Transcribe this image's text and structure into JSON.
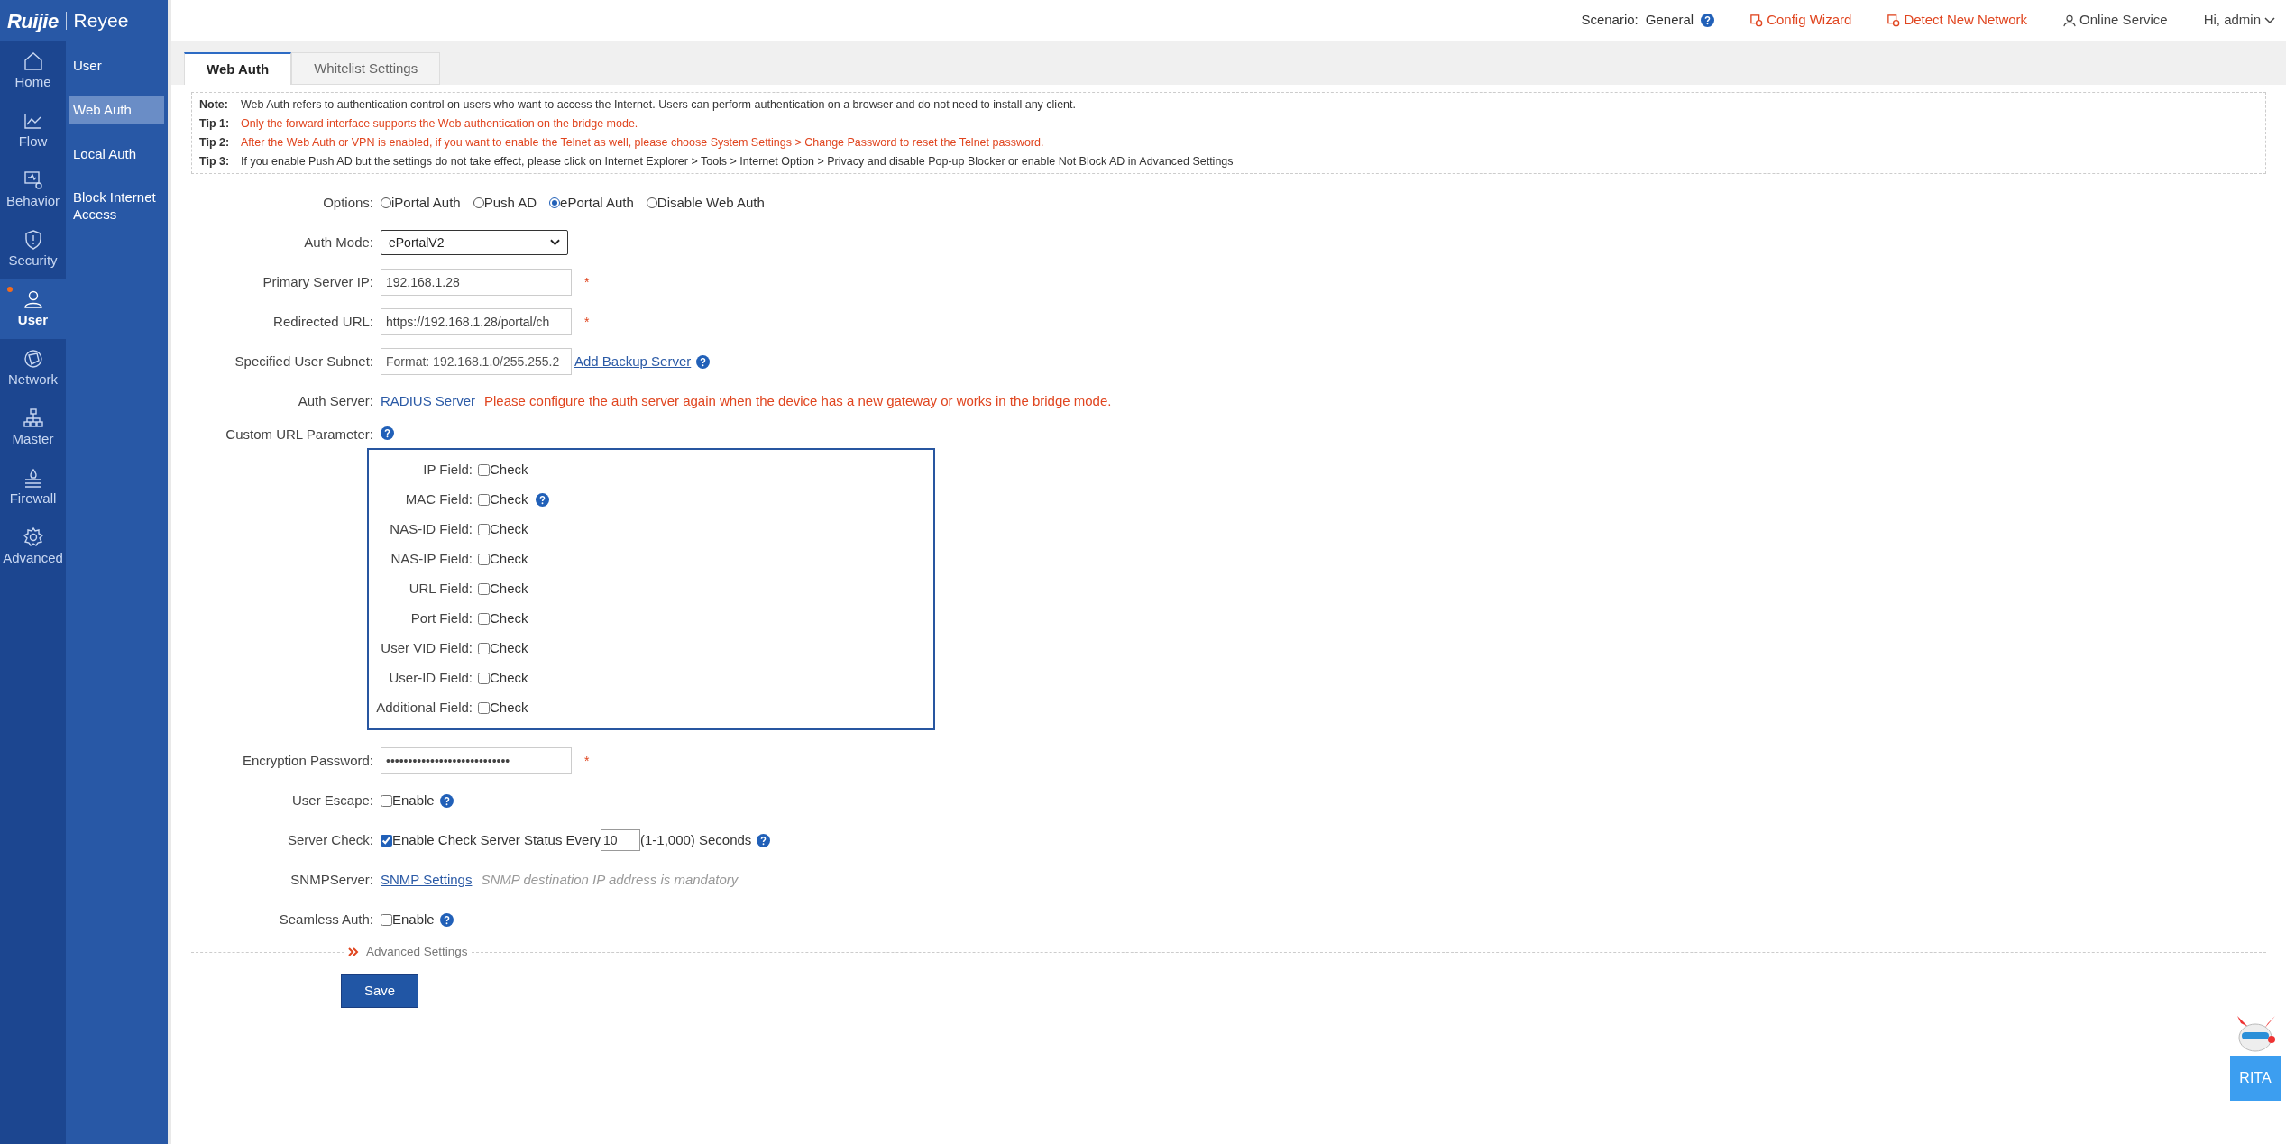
{
  "logo": {
    "brand": "Ruijie",
    "sub_brand": "Reyee"
  },
  "nav": [
    {
      "label": "Home",
      "selected": false,
      "alert": false
    },
    {
      "label": "Flow",
      "selected": false,
      "alert": false
    },
    {
      "label": "Behavior",
      "selected": false,
      "alert": false
    },
    {
      "label": "Security",
      "selected": false,
      "alert": false
    },
    {
      "label": "User",
      "selected": true,
      "alert": true
    },
    {
      "label": "Network",
      "selected": false,
      "alert": false
    },
    {
      "label": "Master",
      "selected": false,
      "alert": false
    },
    {
      "label": "Firewall",
      "selected": false,
      "alert": false
    },
    {
      "label": "Advanced",
      "selected": false,
      "alert": false
    }
  ],
  "subnav": [
    {
      "label": "User",
      "selected": false
    },
    {
      "label": "Web Auth",
      "selected": true
    },
    {
      "label": "Local Auth",
      "selected": false
    },
    {
      "label": "Block Internet Access",
      "selected": false
    }
  ],
  "header": {
    "scenario_label": "Scenario:",
    "scenario": "General",
    "links": [
      {
        "label": "Config Wizard",
        "kind": "warn"
      },
      {
        "label": "Detect New Network",
        "kind": "warn"
      },
      {
        "label": "Online Service",
        "kind": "service"
      }
    ],
    "user": "Hi, admin"
  },
  "tabs": [
    {
      "label": "Web Auth",
      "selected": true
    },
    {
      "label": "Whitelist Settings",
      "selected": false
    }
  ],
  "notes": [
    {
      "label": "Note:",
      "text": "Web Auth refers to authentication control on users who want to access the Internet. Users can perform authentication on a browser and do not need to install any client.",
      "warning": false
    },
    {
      "label": "Tip 1:",
      "text": "Only the forward interface supports the Web authentication on the bridge mode.",
      "warning": true
    },
    {
      "label": "Tip 2:",
      "text": "After the Web Auth or VPN is enabled, if you want to enable the Telnet as well, please choose System Settings > Change Password to reset the Telnet password.",
      "warning": true
    },
    {
      "label": "Tip 3:",
      "text": "If you enable Push AD but the settings do not take effect, please click on Internet Explorer > Tools > Internet Option > Privacy and disable Pop-up Blocker or enable Not Block AD in Advanced Settings",
      "warning": false
    }
  ],
  "form": [
    {
      "kind": "radio",
      "label": "Options:",
      "options": [
        {
          "label": "iPortal Auth",
          "selected": false
        },
        {
          "label": "Push AD",
          "selected": false
        },
        {
          "label": "ePortal Auth",
          "selected": true
        },
        {
          "label": "Disable Web Auth",
          "selected": false
        }
      ]
    },
    {
      "kind": "select",
      "label": "Auth Mode:",
      "value": "ePortalV2"
    },
    {
      "kind": "input",
      "label": "Primary Server IP:",
      "value": "192.168.1.28",
      "required_mark": "*"
    },
    {
      "kind": "input",
      "label": "Redirected URL:",
      "value": "https://192.168.1.28/portal/ch",
      "required_mark": "*"
    },
    {
      "kind": "input",
      "label": "Specified User Subnet:",
      "placeholder": "Format: 192.168.1.0/255.255.2",
      "link": "Add Backup Server",
      "help": true
    },
    {
      "kind": "link",
      "label": "Auth Server:",
      "link": "RADIUS Server",
      "warning": "Please configure the auth server again when the device has a new gateway or works in the bridge mode."
    },
    {
      "kind": "group",
      "label": "Custom URL Parameter:",
      "help": true,
      "fields": [
        {
          "label": "IP Field:",
          "option": "Check",
          "checked": false,
          "help": false
        },
        {
          "label": "MAC Field:",
          "option": "Check",
          "checked": false,
          "help": true
        },
        {
          "label": "NAS-ID Field:",
          "option": "Check",
          "checked": false,
          "help": false
        },
        {
          "label": "NAS-IP Field:",
          "option": "Check",
          "checked": false,
          "help": false
        },
        {
          "label": "URL Field:",
          "option": "Check",
          "checked": false,
          "help": false
        },
        {
          "label": "Port Field:",
          "option": "Check",
          "checked": false,
          "help": false
        },
        {
          "label": "User VID Field:",
          "option": "Check",
          "checked": false,
          "help": false
        },
        {
          "label": "User-ID Field:",
          "option": "Check",
          "checked": false,
          "help": false
        },
        {
          "label": "Additional Field:",
          "option": "Check",
          "checked": false,
          "help": false
        }
      ]
    },
    {
      "kind": "input",
      "label": "Encryption Password:",
      "value": "••••••••••••••••••••••••••••",
      "required_mark": "*"
    },
    {
      "kind": "checkbox",
      "label": "User Escape:",
      "option": "Enable",
      "checked": false,
      "help": true
    },
    {
      "kind": "checkbox",
      "label": "Server Check:",
      "option": "Enable Check Server Status Every",
      "checked": true,
      "value": "10",
      "suffix": "(1-1,000) Seconds",
      "help": true
    },
    {
      "kind": "link",
      "label": "SNMPServer:",
      "link": "SNMP Settings",
      "hint": "SNMP destination IP address is mandatory"
    },
    {
      "kind": "checkbox",
      "label": "Seamless Auth:",
      "option": "Enable",
      "checked": false,
      "help": true
    }
  ],
  "advanced": "Advanced Settings",
  "save": "Save",
  "assistant": {
    "label": "RITA"
  }
}
